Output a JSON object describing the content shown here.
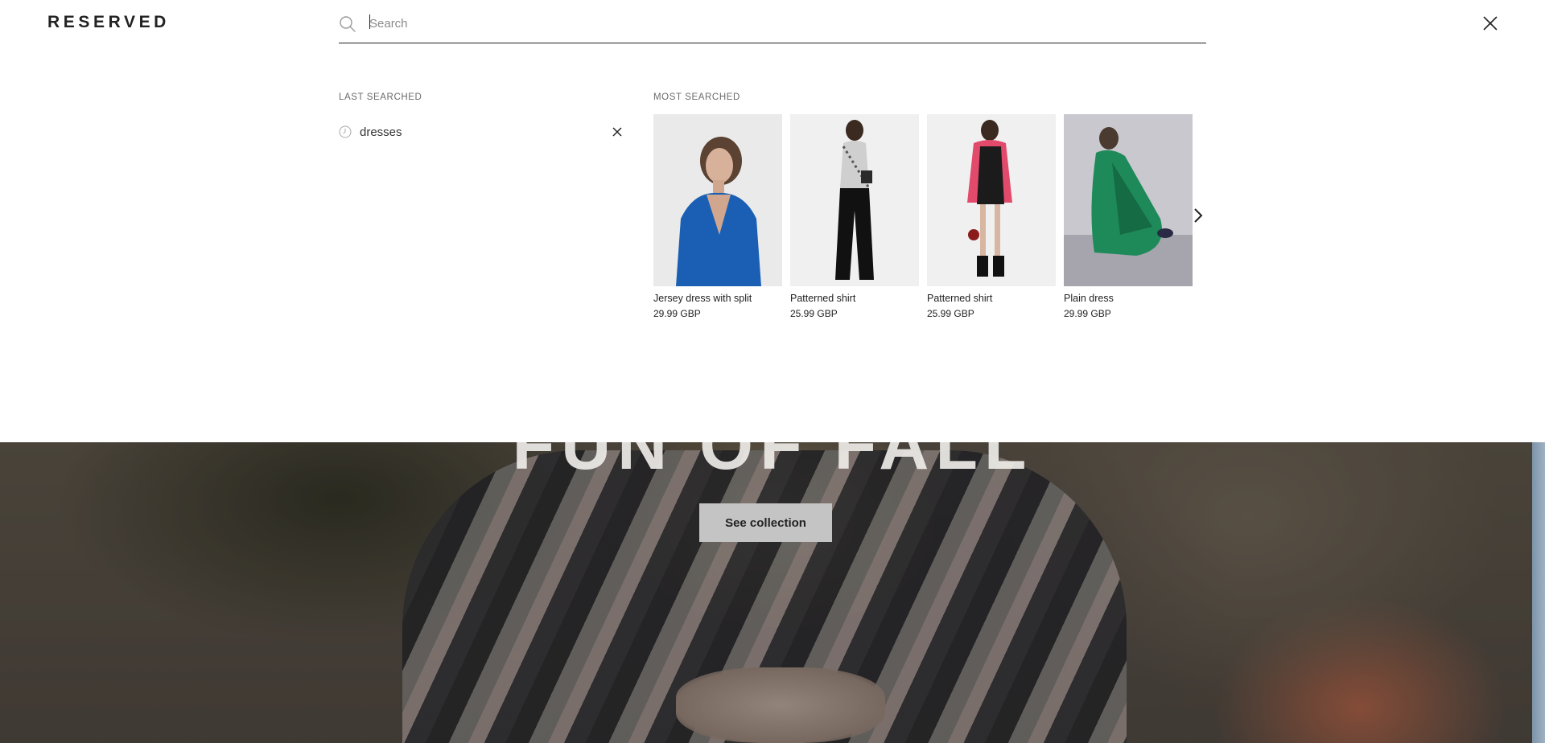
{
  "brand": {
    "logo": "RESERVED"
  },
  "search": {
    "placeholder": "Search",
    "value": ""
  },
  "last_searched": {
    "title": "LAST SEARCHED",
    "items": [
      {
        "label": "dresses"
      }
    ]
  },
  "most_searched": {
    "title": "MOST SEARCHED",
    "products": [
      {
        "name": "Jersey dress with split",
        "price": "29.99 GBP",
        "image": "woman-in-blue-dress"
      },
      {
        "name": "Patterned shirt",
        "price": "25.99 GBP",
        "image": "woman-in-patterned-shirt-black-trousers"
      },
      {
        "name": "Patterned shirt",
        "price": "25.99 GBP",
        "image": "woman-in-pink-shirt-black-dress"
      },
      {
        "name": "Plain dress",
        "price": "29.99 GBP",
        "image": "woman-in-green-dress-seated"
      }
    ]
  },
  "hero": {
    "heading": "FUN OF FALL",
    "cta": "See collection"
  },
  "colors": {
    "text": "#222222",
    "muted": "#6b6b6b",
    "cta_bg": "#c4c4c4"
  },
  "icons": [
    "search-icon",
    "close-icon",
    "clock-icon",
    "remove-icon",
    "chevron-right-icon"
  ]
}
